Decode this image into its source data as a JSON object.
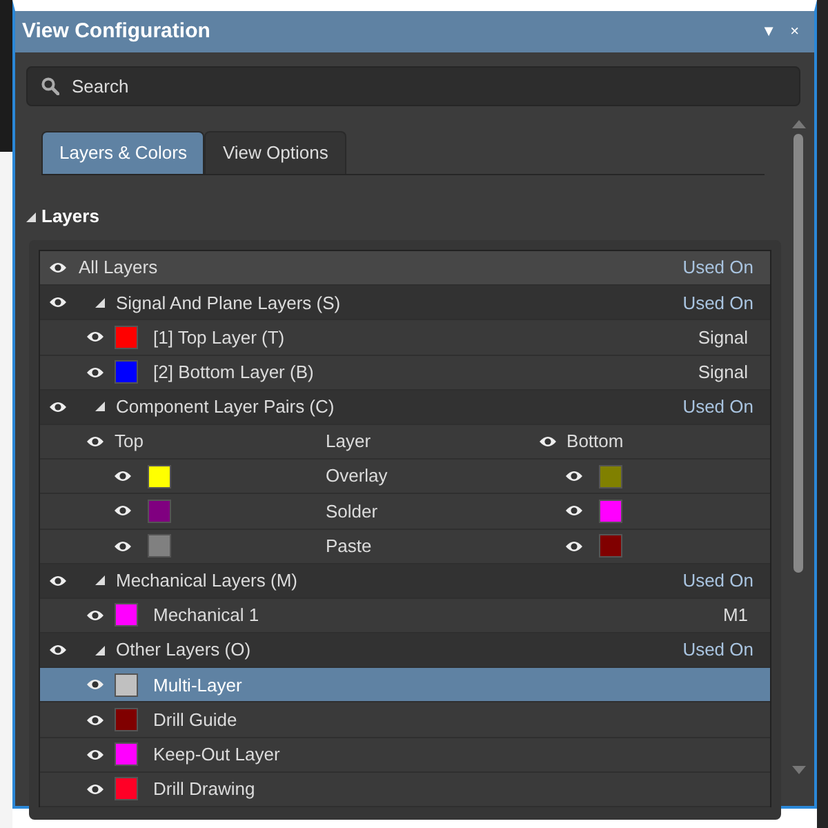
{
  "window": {
    "title": "View Configuration",
    "controls": [
      "▼",
      "×"
    ]
  },
  "search": {
    "placeholder": "Search"
  },
  "tabs": [
    {
      "label": "Layers & Colors",
      "selected": true
    },
    {
      "label": "View Options",
      "selected": false
    }
  ],
  "layers_section": {
    "title": "Layers",
    "expanded": true,
    "rows": [
      {
        "kind": "all",
        "label": "All Layers",
        "used_on": "Used On"
      },
      {
        "kind": "group",
        "label": "Signal And Plane Layers (S)",
        "expanded": true,
        "used_on": "Used On",
        "children": [
          {
            "kind": "layer",
            "color": "#ff0000",
            "label": "[1] Top Layer (T)",
            "used_on": "Signal",
            "selected": false
          },
          {
            "kind": "layer",
            "color": "#0000ff",
            "label": "[2] Bottom Layer (B)",
            "used_on": "Signal",
            "selected": false
          }
        ]
      },
      {
        "kind": "group",
        "label": "Component Layer Pairs (C)",
        "expanded": true,
        "used_on": "Used On",
        "children": [
          {
            "kind": "pair_header",
            "top": "Top",
            "layer": "Layer",
            "bottom": "Bottom"
          },
          {
            "kind": "pair",
            "top": {
              "color": "#ffff00"
            },
            "layer": "Overlay",
            "bottom": {
              "color": "#808000"
            }
          },
          {
            "kind": "pair",
            "top": {
              "color": "#800080"
            },
            "layer": "Solder",
            "bottom": {
              "color": "#ff00ff"
            }
          },
          {
            "kind": "pair",
            "top": {
              "color": "#808080"
            },
            "layer": "Paste",
            "bottom": {
              "color": "#800000"
            }
          }
        ]
      },
      {
        "kind": "group",
        "label": "Mechanical Layers (M)",
        "expanded": true,
        "used_on": "Used On",
        "children": [
          {
            "kind": "layer",
            "color": "#ff00ff",
            "label": "Mechanical 1",
            "used_on": "M1",
            "selected": false
          }
        ]
      },
      {
        "kind": "group",
        "label": "Other Layers (O)",
        "expanded": true,
        "used_on": "Used On",
        "children": [
          {
            "kind": "layer",
            "color": "#c0c0c0",
            "label": "Multi-Layer",
            "selected": true
          },
          {
            "kind": "layer",
            "color": "#800000",
            "label": "Drill Guide",
            "selected": false
          },
          {
            "kind": "layer",
            "color": "#ff00ff",
            "label": "Keep-Out Layer",
            "selected": false
          },
          {
            "kind": "layer",
            "color": "#ff0026",
            "label": "Drill Drawing",
            "selected": false
          }
        ]
      }
    ]
  }
}
